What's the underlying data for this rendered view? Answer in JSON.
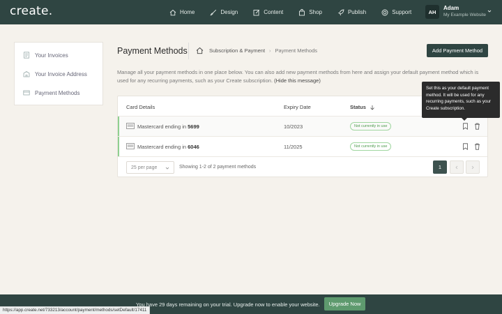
{
  "topbar": {
    "logo": "create.",
    "nav": [
      {
        "label": "Home",
        "icon": "home-icon"
      },
      {
        "label": "Design",
        "icon": "brush-icon"
      },
      {
        "label": "Content",
        "icon": "edit-icon"
      },
      {
        "label": "Shop",
        "icon": "shopping-bag-icon"
      },
      {
        "label": "Publish",
        "icon": "rocket-icon"
      },
      {
        "label": "Support",
        "icon": "lifebuoy-icon"
      }
    ],
    "account": {
      "initials": "AH",
      "name": "Adam",
      "site": "My Example Website"
    }
  },
  "sidebar": {
    "items": [
      {
        "label": "Your Invoices",
        "icon": "invoice-icon"
      },
      {
        "label": "Your Invoice Address",
        "icon": "building-icon"
      },
      {
        "label": "Payment Methods",
        "icon": "credit-card-icon"
      }
    ]
  },
  "header": {
    "title": "Payment Methods",
    "breadcrumb": [
      "Subscription & Payment",
      "Payment Methods"
    ],
    "add_button": "Add Payment Method"
  },
  "intro": {
    "text": "Manage all your payment methods in one place below. You can also add new payment methods from here and assign your default payment method which is used for any recurring payments, such as your Create subscription.",
    "hide_link": "(Hide this message)"
  },
  "table": {
    "columns": {
      "card": "Card Details",
      "expiry": "Expiry Date",
      "status": "Status"
    },
    "rows": [
      {
        "card_prefix": "Mastercard ending in",
        "last4": "5699",
        "expiry": "10/2023",
        "status": "Not currently in use"
      },
      {
        "card_prefix": "Mastercard ending in",
        "last4": "6046",
        "expiry": "11/2025",
        "status": "Not currently in use"
      }
    ],
    "per_page": "25 per page",
    "showing": "Showing 1-2 of 2 payment methods",
    "current_page": "1"
  },
  "tooltip": {
    "text": "Set this as your default payment method. It will be used for any recurring payments, such as your Create subscription."
  },
  "trial": {
    "text": "You have 29 days remaining on your trial. Upgrade now to enable your website.",
    "button": "Upgrade Now"
  },
  "statusbar": {
    "url": "https://app.create.net/733213/account/payment/methods/setDefault/17411"
  },
  "colors": {
    "topbar": "#2f4542",
    "accent_green": "#8fd08f",
    "upgrade_button": "#5e9a6e",
    "page_bg": "#f5f2ec"
  }
}
